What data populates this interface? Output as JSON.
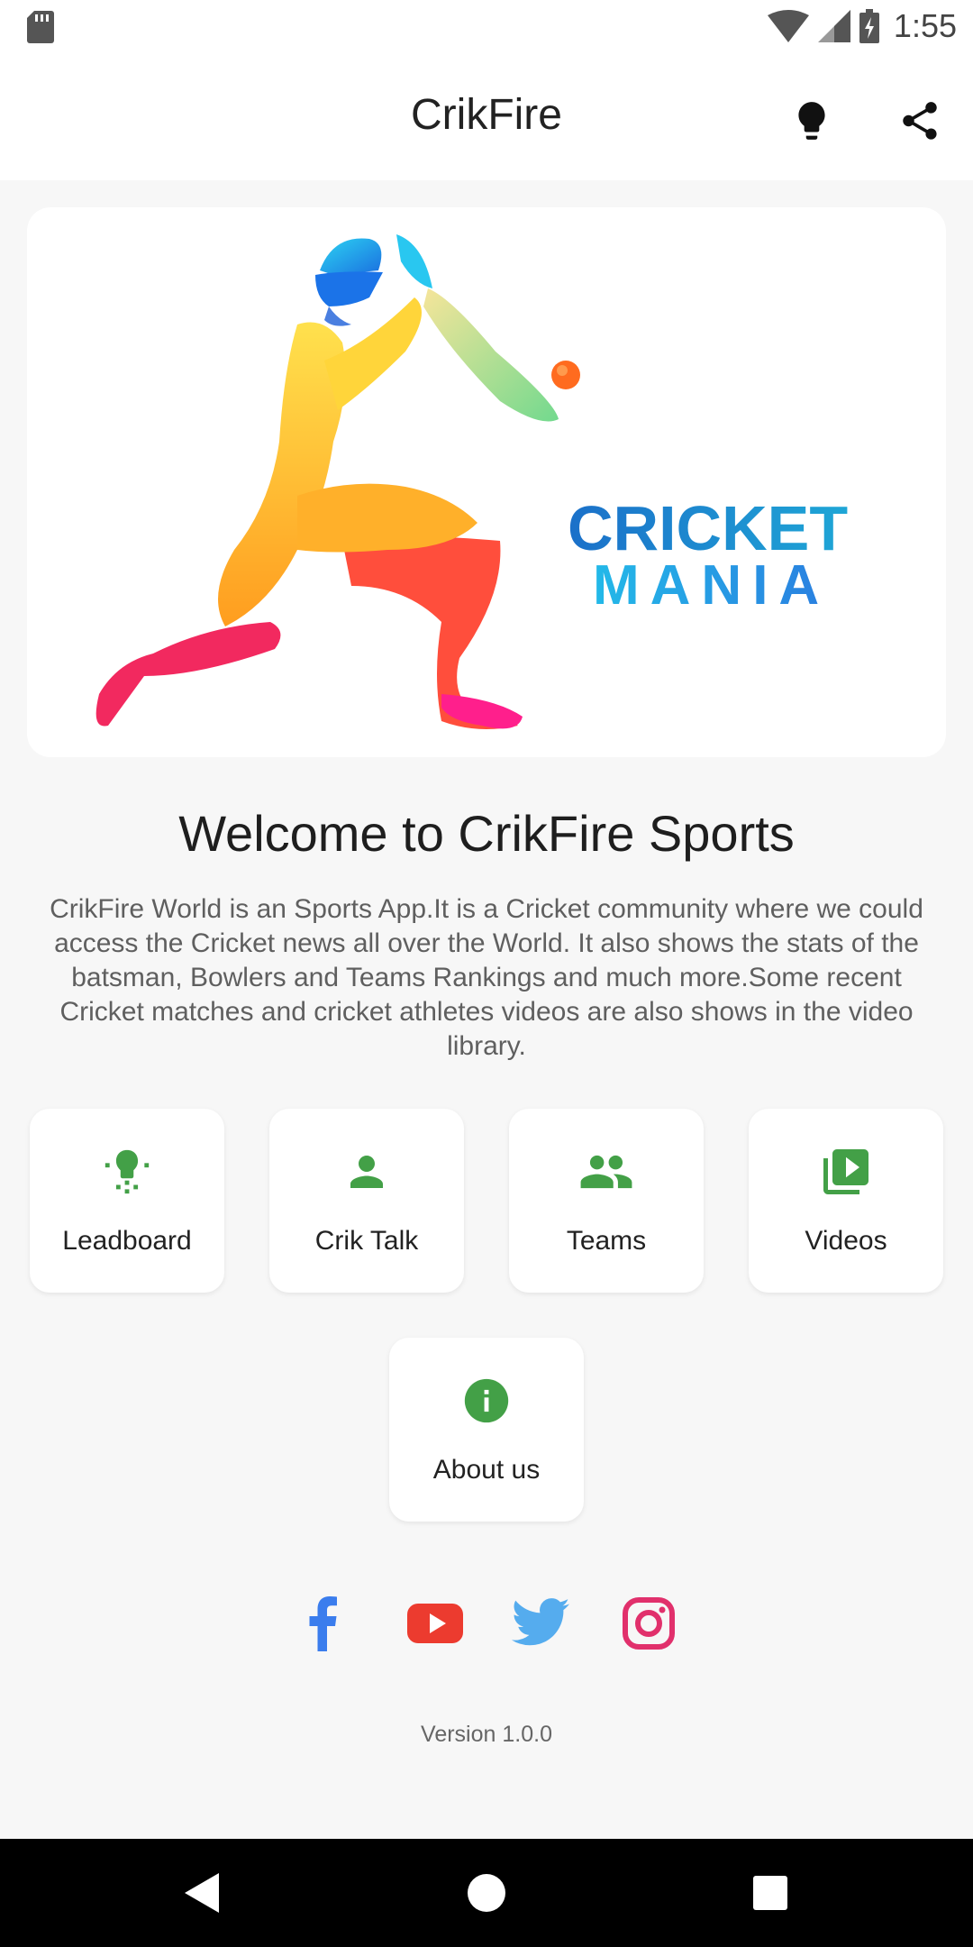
{
  "status_bar": {
    "time": "1:55"
  },
  "app_bar": {
    "title": "CrikFire"
  },
  "hero": {
    "text_line1": "CRICKET",
    "text_line2": "MANIA"
  },
  "welcome": {
    "heading": "Welcome to CrikFire Sports",
    "description": "CrikFire World is an Sports App.It is a Cricket community where we could access the Cricket news all over the World. It also shows the stats of the batsman, Bowlers and Teams Rankings and much more.Some recent Cricket matches and cricket athletes videos are also shows in the video library."
  },
  "menu": [
    {
      "label": "Leadboard",
      "icon": "lightbulb-icon"
    },
    {
      "label": "Crik Talk",
      "icon": "person-icon"
    },
    {
      "label": "Teams",
      "icon": "people-icon"
    },
    {
      "label": "Videos",
      "icon": "video-library-icon"
    },
    {
      "label": "About us",
      "icon": "info-icon"
    }
  ],
  "colors": {
    "accent_green": "#43a047",
    "facebook": "#3b7ded",
    "youtube": "#ec3b2f",
    "twitter": "#55acee",
    "instagram": "#e1306c"
  },
  "footer": {
    "version": "Version 1.0.0"
  }
}
